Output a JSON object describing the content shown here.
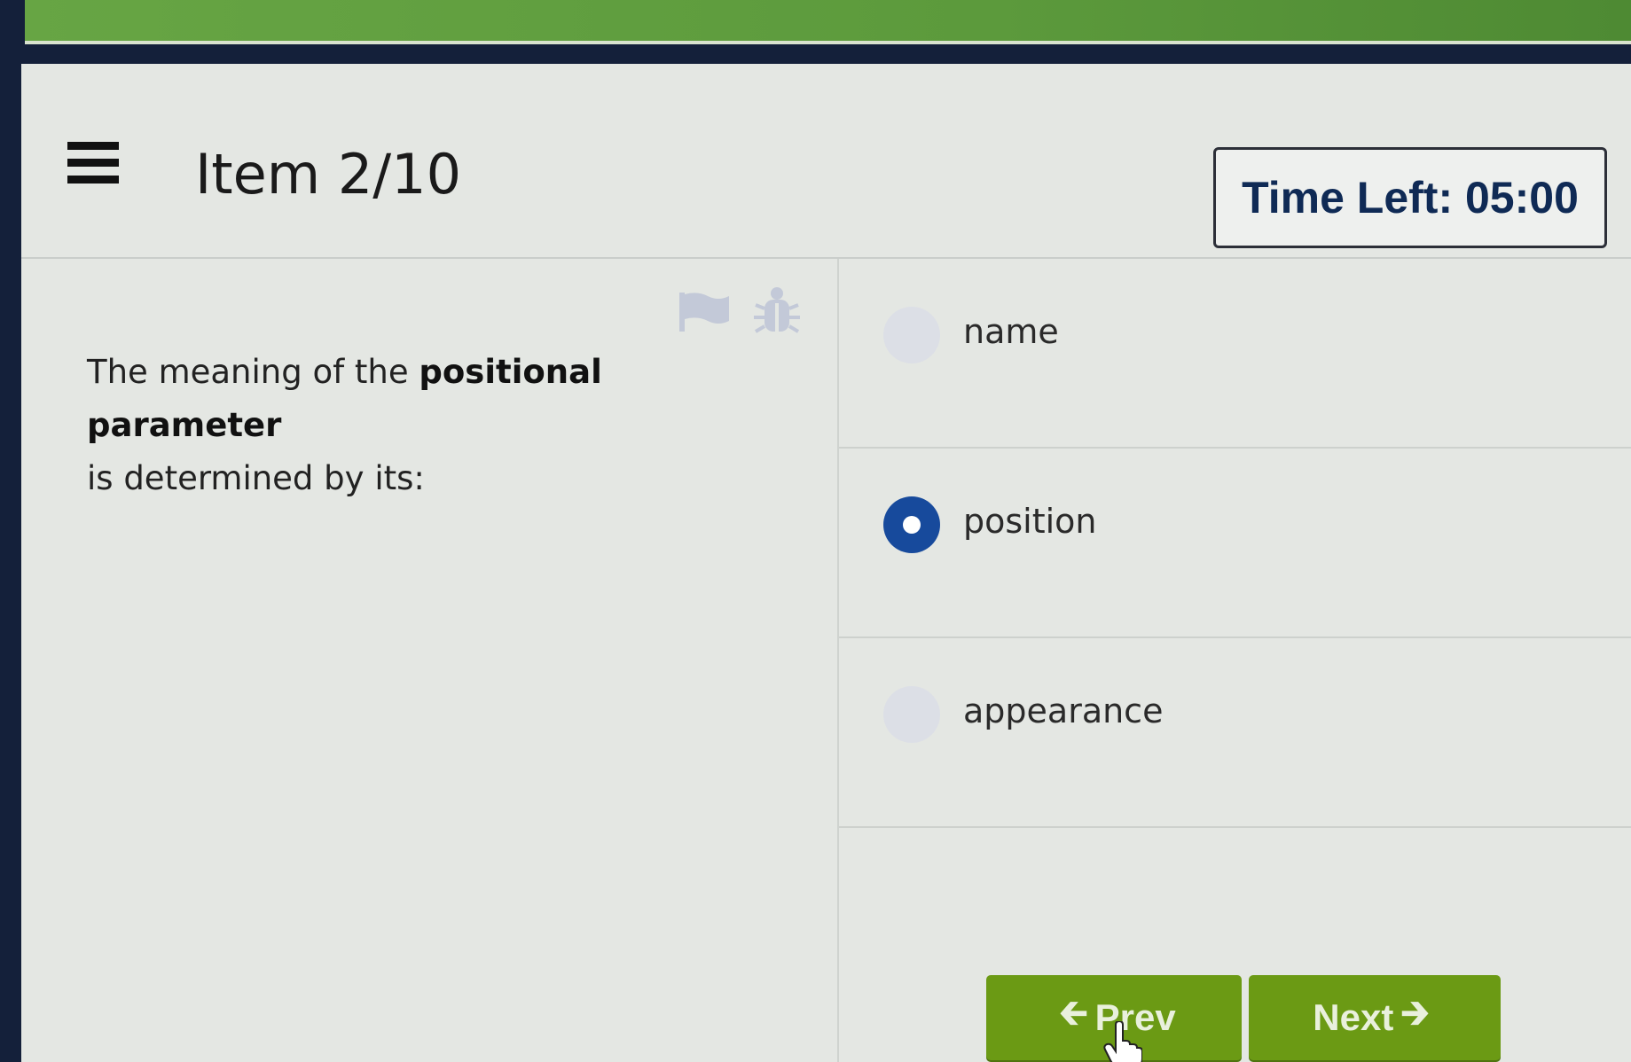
{
  "header": {
    "menu_icon": "hamburger-menu-icon",
    "title": "Item 2/10",
    "timer": "Time Left: 05:00"
  },
  "question": {
    "text_before": "The meaning of the",
    "text_bold": "positional parameter",
    "text_after": "is determined by its:",
    "flag_icon": "flag-icon",
    "bug_icon": "bug-icon"
  },
  "options": [
    {
      "label": "name",
      "selected": false
    },
    {
      "label": "position",
      "selected": true
    },
    {
      "label": "appearance",
      "selected": false
    }
  ],
  "nav": {
    "prev_label": "Prev",
    "next_label": "Next"
  },
  "colors": {
    "accent_green": "#6b9a14",
    "selected_radio": "#174a9c",
    "timer_text": "#0f2a55"
  }
}
